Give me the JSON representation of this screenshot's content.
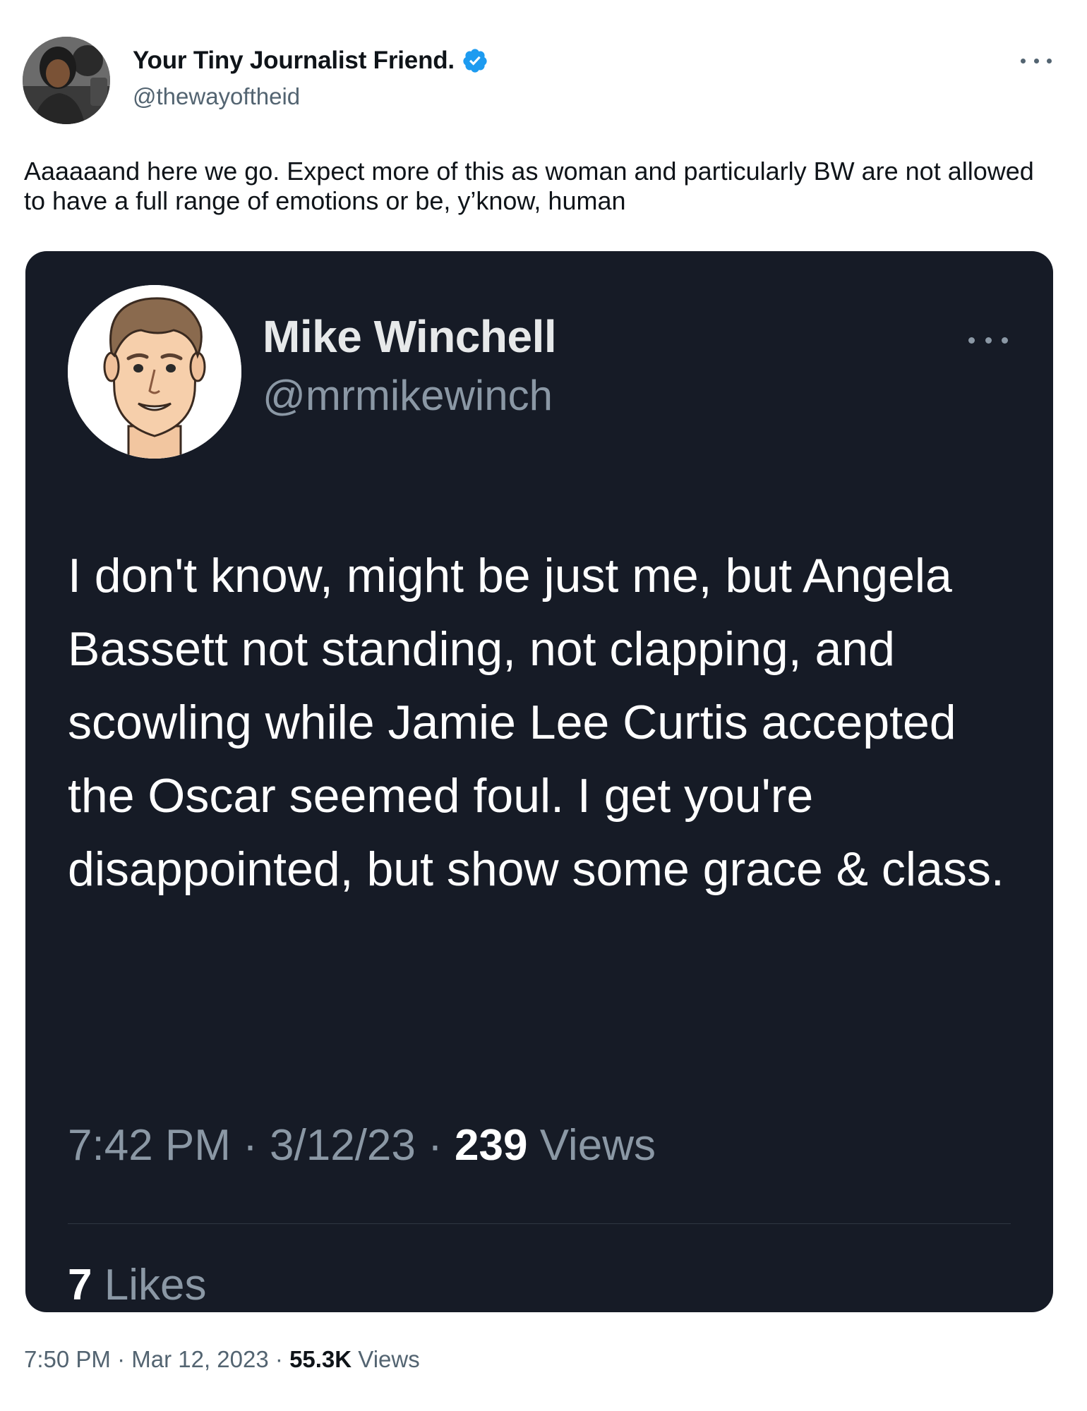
{
  "tweet": {
    "author_name": "Your Tiny Journalist Friend.",
    "author_handle": "@thewayoftheid",
    "text": "Aaaaaand here we go. Expect more of this as woman and particularly BW are not allowed to have a full range of emotions or be, y’know, human",
    "time": "7:50 PM",
    "date": "Mar 12, 2023",
    "separator": "·",
    "views_count": "55.3K",
    "views_label": "Views"
  },
  "quoted": {
    "author_name": "Mike Winchell",
    "author_handle": "@mrmikewinch",
    "text": "I don't know, might be just me, but Angela Bassett not standing, not clapping, and scowling while Jamie Lee Curtis accepted the Oscar seemed foul. I get you're disappointed, but show some grace & class.",
    "time": "7:42 PM",
    "date": "3/12/23",
    "separator": "·",
    "views_count": "239",
    "views_label": "Views",
    "likes_count": "7",
    "likes_label": "Likes"
  },
  "icons": {
    "verified": "verified-badge-icon",
    "more": "more-options-icon"
  },
  "colors": {
    "verified_blue": "#1d9bf0",
    "card_background": "#161b26",
    "secondary_text": "#536471"
  }
}
